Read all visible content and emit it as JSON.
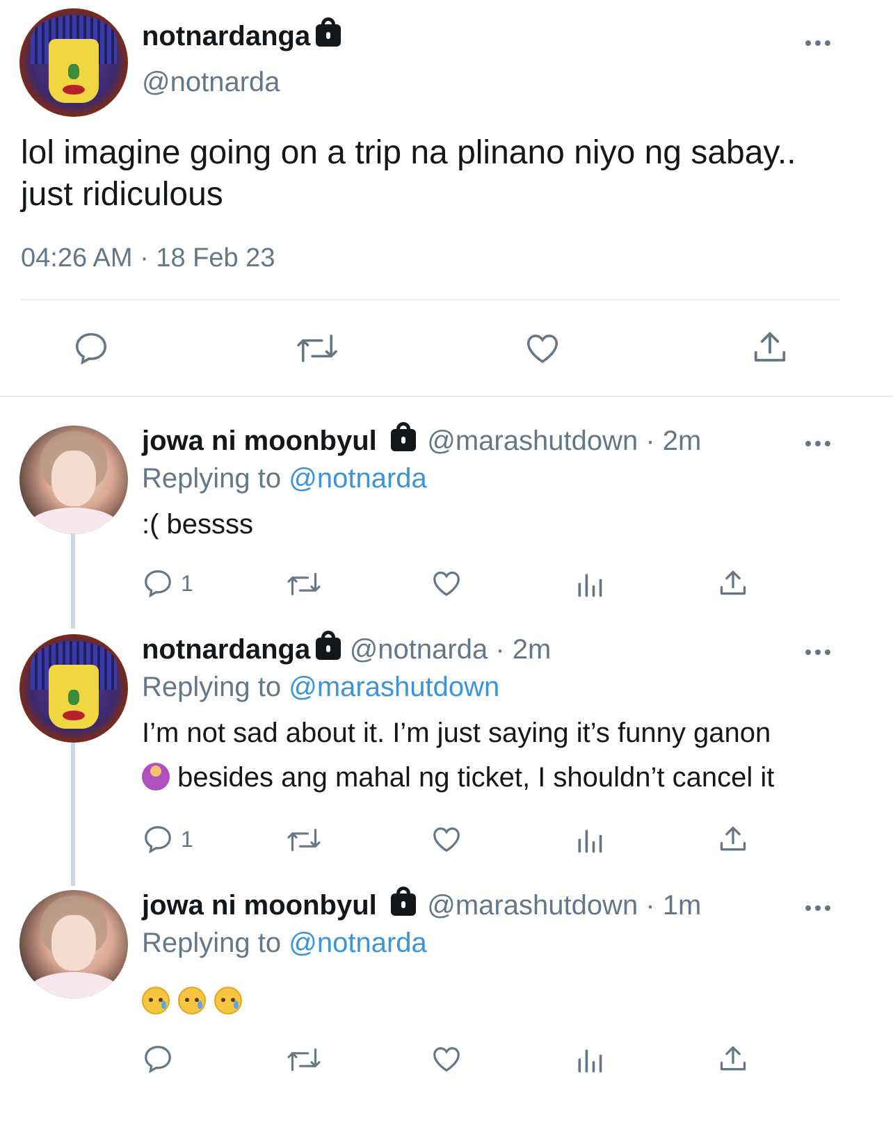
{
  "main_tweet": {
    "display_name": "notnardanga",
    "handle": "@notnarda",
    "text": "lol imagine going on a trip na plinano niyo ng sabay.. just ridiculous",
    "timestamp": "04:26 AM · 18 Feb 23",
    "actions": [
      "reply-icon",
      "retweet-icon",
      "like-icon",
      "share-icon"
    ]
  },
  "replies": [
    {
      "display_name": "jowa ni moonbyul",
      "meta": "@marashutdown · 2m",
      "replying_prefix": "Replying to ",
      "replying_to": "@notnarda",
      "text": ":( bessss",
      "reply_count": "1"
    },
    {
      "display_name": "notnardanga",
      "meta": "@notnarda · 2m",
      "replying_prefix": "Replying to ",
      "replying_to": "@marashutdown",
      "text_line1": "I’m not sad about it. I’m just saying it’s funny ganon",
      "text_line2": " besides ang mahal ng ticket, I shouldn’t cancel it",
      "reply_count": "1"
    },
    {
      "display_name": "jowa ni moonbyul",
      "meta": "@marashutdown · 1m",
      "replying_prefix": "Replying to ",
      "replying_to": "@notnarda",
      "emojis": [
        "crying-face-emoji",
        "crying-face-emoji",
        "crying-face-emoji"
      ],
      "reply_count": ""
    }
  ],
  "colors": {
    "text": "#14171a",
    "secondary": "#657786",
    "link": "#3b94d9",
    "divider": "#e6ecf0"
  }
}
